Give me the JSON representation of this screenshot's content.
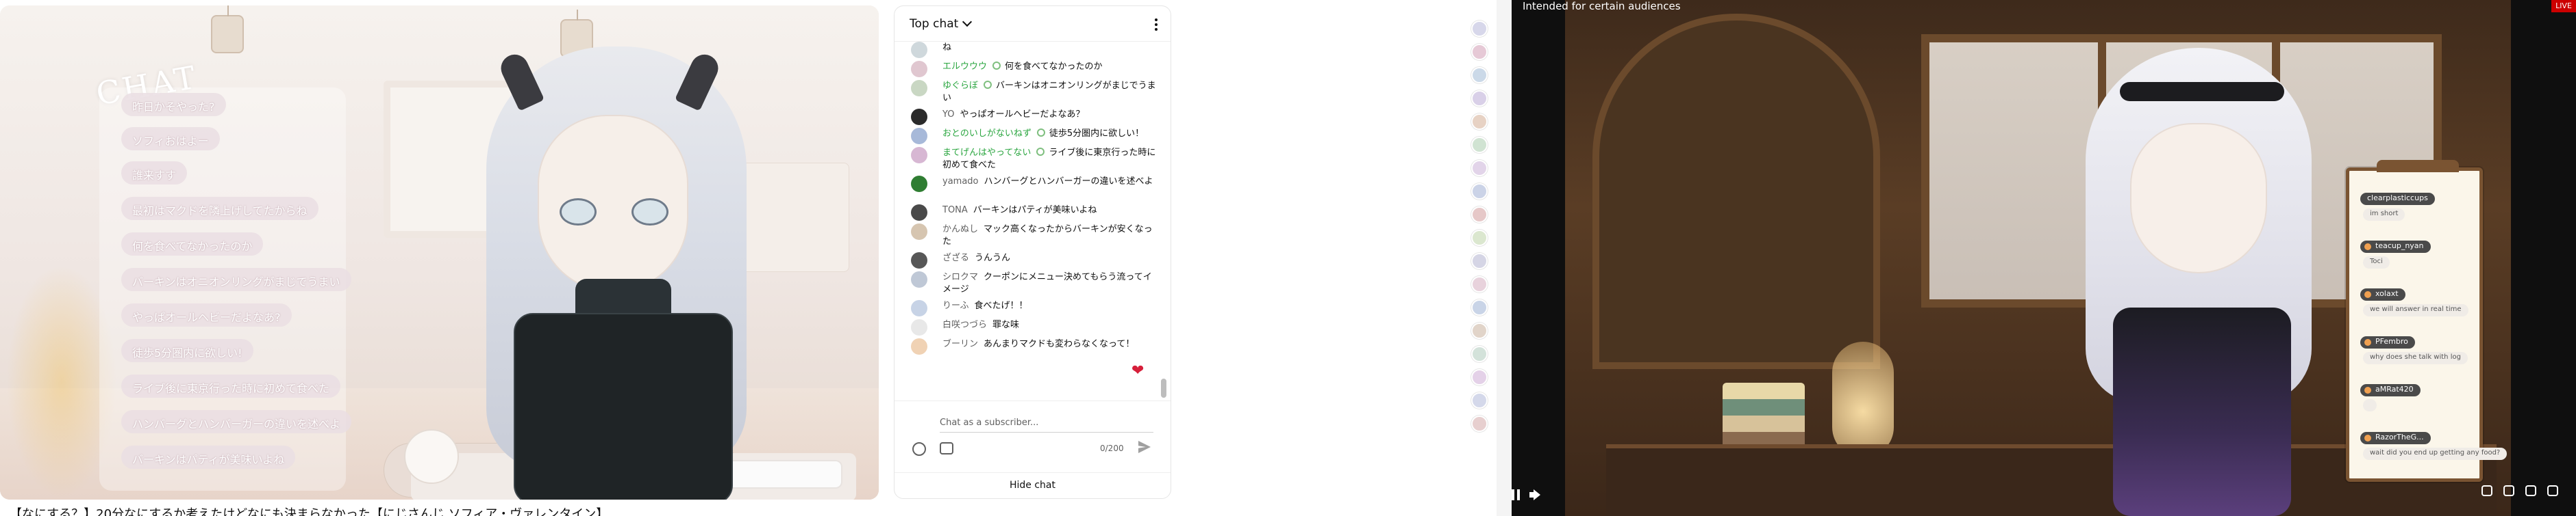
{
  "left_video": {
    "overlay_title": "CHAT",
    "bubbles": [
      "昨日かそやった?",
      "ソフィおはよー",
      "誰来すす",
      "最初はマクドを隣上げしてたからね",
      "何を食べてなかったのか",
      "バーキンはオニオンリングがまじでうまい",
      "やっぱオールヘビーだよなあ?",
      "徒歩5分圏内に欲しい!",
      "ライブ後に東京行った時に初めて食べた",
      "ハンバーグとハンバーガーの違いを述べよ",
      "バーキンはパティが美味いよね"
    ],
    "caption": "【なにする？】20分なにするか考えたけどなにも決まらなかった【にじさんじ ソフィア・ヴァレンタイン】"
  },
  "live_chat": {
    "header_label": "Top chat",
    "messages": [
      {
        "author": "",
        "text": "ね",
        "avatar_color": "#cfd8dc",
        "member": false
      },
      {
        "author": "エルウウウ",
        "text": "何を食べてなかったのか",
        "avatar_color": "#e0c7d0",
        "member": true
      },
      {
        "author": "ゆぐらぼ",
        "text": "バーキンはオニオンリングがまじでうまい",
        "avatar_color": "#c9d7c3",
        "member": true
      },
      {
        "author": "YO",
        "text": "やっぱオールヘビーだよなあ？",
        "avatar_color": "#2b2b2b",
        "member": false
      },
      {
        "author": "おとのいしがないねず",
        "text": "徒歩5分圏内に欲しい！",
        "avatar_color": "#a7b9d9",
        "member": true
      },
      {
        "author": "まてげんはやってない",
        "text": "ライブ後に東京行った時に初めて食べた",
        "avatar_color": "#d7b7d3",
        "member": true
      },
      {
        "author": "yamado",
        "text": "ハンバーグとハンバーガーの違いを述べよ",
        "avatar_color": "#2f7d32",
        "member": false
      },
      {
        "author": "TONA",
        "text": "バーキンはパティが美味いよね",
        "avatar_color": "#4a4a4a",
        "member": false
      },
      {
        "author": "かんぬし",
        "text": "マック高くなったからバーキンが安くなった",
        "avatar_color": "#d6c5b0",
        "member": false
      },
      {
        "author": "ざざる",
        "text": "うんうん",
        "avatar_color": "#575757",
        "member": false
      },
      {
        "author": "シロクマ",
        "text": "クーポンにメニュー決めてもらう流ってイメージ",
        "avatar_color": "#bfc8d6",
        "member": false
      },
      {
        "author": "りーふ",
        "text": "食べたげ！！",
        "avatar_color": "#c7d3e6",
        "member": false
      },
      {
        "author": "白咲つづら",
        "text": "罪な味",
        "avatar_color": "#e8e8e8",
        "member": false
      },
      {
        "author": "ブーリン",
        "text": "あんまりマクドも変わらなくなって！",
        "avatar_color": "#f0d2b4",
        "member": false
      }
    ],
    "input_placeholder": "Chat as a subscriber...",
    "counter": "0/200",
    "hide_chat_label": "Hide chat"
  },
  "right_player": {
    "warning_text": "Intended for certain audiences",
    "live_badge": "LIVE",
    "board": [
      {
        "name": "clearplasticcups",
        "text": "im short",
        "dot": false
      },
      {
        "name": "teacup_nyan",
        "text": "Toci",
        "dot": true
      },
      {
        "name": "xolaxt",
        "text": "we will answer in real time",
        "dot": true
      },
      {
        "name": "PFembro",
        "text": "why does she talk with log",
        "dot": true
      },
      {
        "name": "aMRat420",
        "text": "",
        "dot": true
      },
      {
        "name": "RazorTheG...",
        "text": "wait did you end up getting any food?",
        "dot": true
      }
    ]
  },
  "colors": {
    "live_red": "#cc0000",
    "member_green": "#2ba640",
    "heart_red": "#d61f3a"
  },
  "icons": [
    "chevron-down-icon",
    "more-vert-icon",
    "emoji-icon",
    "super-chat-icon",
    "send-icon",
    "pause-icon",
    "volume-icon",
    "settings-icon",
    "miniplayer-icon",
    "theater-icon",
    "fullscreen-icon",
    "heart-icon"
  ]
}
